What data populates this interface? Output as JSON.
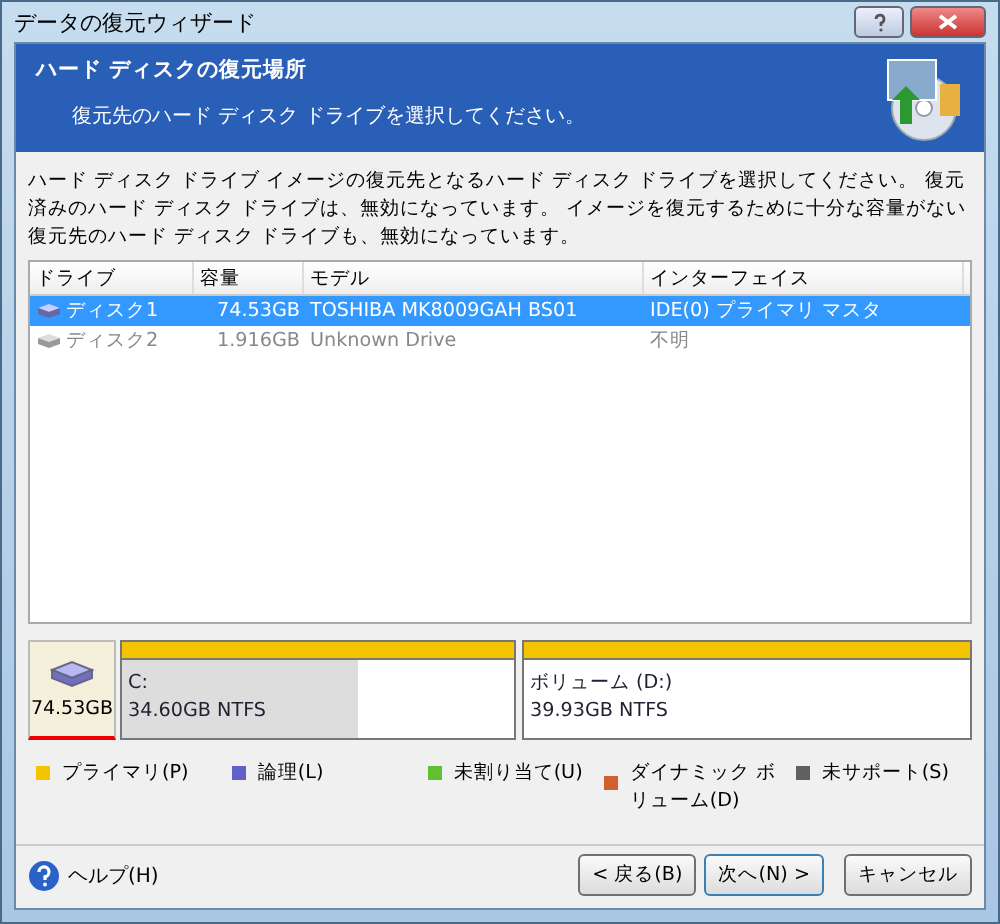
{
  "window": {
    "title": "データの復元ウィザード"
  },
  "header": {
    "title": "ハード ディスクの復元場所",
    "subtitle": "復元先のハード ディスク ドライブを選択してください。"
  },
  "description": "ハード ディスク ドライブ イメージの復元先となるハード ディスク ドライブを選択してください。 復元済みのハード ディスク ドライブは、無効になっています。 イメージを復元するために十分な容量がない復元先のハード ディスク ドライブも、無効になっています。",
  "table": {
    "columns": [
      "ドライブ",
      "容量",
      "モデル",
      "インターフェイス"
    ],
    "rows": [
      {
        "cells": [
          "ディスク1",
          "74.53GB",
          "TOSHIBA MK8009GAH BS01",
          "IDE(0) プライマリ マスタ"
        ],
        "selected": true,
        "disabled": false
      },
      {
        "cells": [
          "ディスク2",
          "1.916GB",
          "Unknown Drive",
          "不明"
        ],
        "selected": false,
        "disabled": true
      }
    ]
  },
  "disk_map": {
    "size": "74.53GB",
    "partitions": [
      {
        "name": "C:",
        "info": "34.60GB  NTFS",
        "level": 0.6,
        "color": "#f5c400"
      },
      {
        "name": "ボリューム (D:)",
        "info": "39.93GB  NTFS",
        "level": 0,
        "color": "#f5c400"
      }
    ]
  },
  "legend": [
    {
      "label": "プライマリ(P)",
      "color": "#f5c400"
    },
    {
      "label": "論理(L)",
      "color": "#6060c8"
    },
    {
      "label": "未割り当て(U)",
      "color": "#60c030"
    },
    {
      "label": "ダイナミック ボリューム(D)",
      "color": "#d06030"
    },
    {
      "label": "未サポート(S)",
      "color": "#606060"
    }
  ],
  "footer": {
    "help": "ヘルプ(H)",
    "buttons": [
      "< 戻る(B)",
      "次へ(N) >",
      "キャンセル"
    ]
  }
}
